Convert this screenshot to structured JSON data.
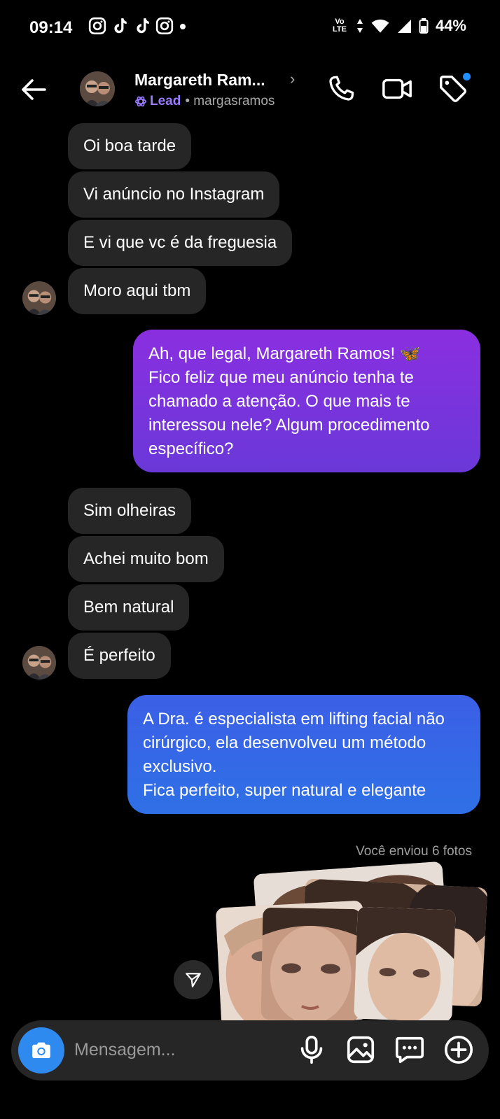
{
  "status_bar": {
    "time": "09:14",
    "network": "Vo LTE",
    "battery": "44%"
  },
  "header": {
    "name": "Margareth Ram...",
    "badge": "Lead",
    "username": "• margasramos"
  },
  "messages": {
    "group1": [
      "Oi boa tarde",
      "Vi anúncio no Instagram",
      "E vi que vc é da freguesia",
      "Moro aqui tbm"
    ],
    "reply1": "Ah, que legal, Margareth Ramos! 🦋\nFico feliz que meu anúncio tenha te chamado a atenção. O que mais te interessou nele? Algum procedimento específico?",
    "group2": [
      "Sim olheiras",
      "Achei muito bom",
      "Bem natural",
      "É perfeito"
    ],
    "reply2": "A Dra. é especialista em lifting facial não cirúrgico, ela desenvolveu um método exclusivo.\nFica perfeito, super natural e elegante",
    "sent_note": "Você enviou 6 fotos"
  },
  "composer": {
    "placeholder": "Mensagem..."
  },
  "colors": {
    "incoming_bubble": "#262626",
    "outgoing_purple": "#7a35dc",
    "outgoing_blue": "#3566e6",
    "accent_blue": "#2f8af0",
    "lead": "#9b7bff"
  }
}
